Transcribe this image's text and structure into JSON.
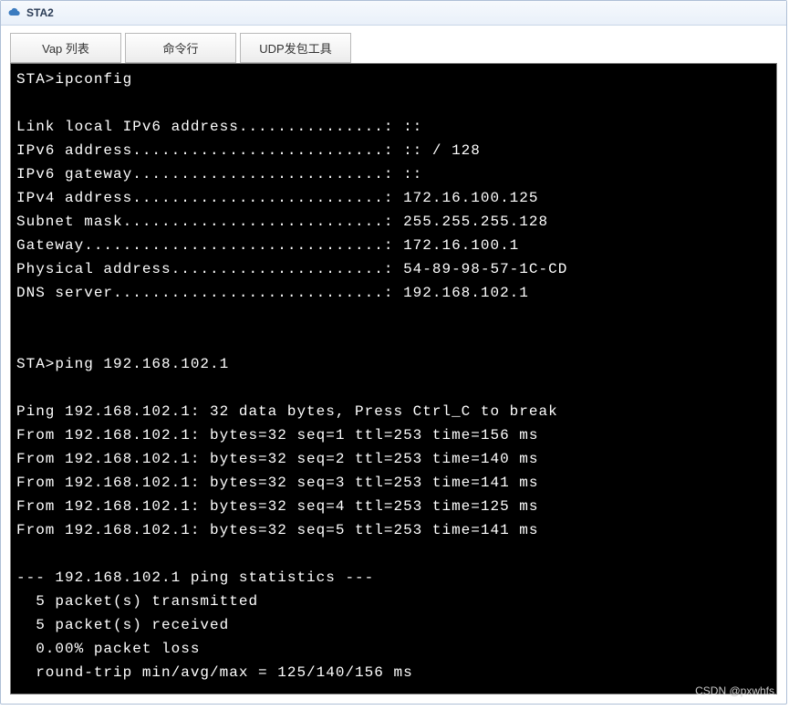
{
  "window": {
    "title": "STA2",
    "icon": "cloud-icon"
  },
  "tabs": [
    {
      "label": "Vap 列表"
    },
    {
      "label": "命令行"
    },
    {
      "label": "UDP发包工具"
    }
  ],
  "terminal": {
    "prompt1": "STA>",
    "cmd1": "ipconfig",
    "ipconfig": {
      "link_local_ipv6_label": "Link local IPv6 address",
      "link_local_ipv6": "::",
      "ipv6_addr_label": "IPv6 address",
      "ipv6_addr": ":: / 128",
      "ipv6_gw_label": "IPv6 gateway",
      "ipv6_gw": "::",
      "ipv4_addr_label": "IPv4 address",
      "ipv4_addr": "172.16.100.125",
      "subnet_label": "Subnet mask",
      "subnet": "255.255.255.128",
      "gateway_label": "Gateway",
      "gateway": "172.16.100.1",
      "phys_label": "Physical address",
      "phys": "54-89-98-57-1C-CD",
      "dns_label": "DNS server",
      "dns": "192.168.102.1"
    },
    "prompt2": "STA>",
    "cmd2": "ping 192.168.102.1",
    "ping": {
      "header": "Ping 192.168.102.1: 32 data bytes, Press Ctrl_C to break",
      "replies": [
        "From 192.168.102.1: bytes=32 seq=1 ttl=253 time=156 ms",
        "From 192.168.102.1: bytes=32 seq=2 ttl=253 time=140 ms",
        "From 192.168.102.1: bytes=32 seq=3 ttl=253 time=141 ms",
        "From 192.168.102.1: bytes=32 seq=4 ttl=253 time=125 ms",
        "From 192.168.102.1: bytes=32 seq=5 ttl=253 time=141 ms"
      ],
      "stats_hdr": "--- 192.168.102.1 ping statistics ---",
      "stats": [
        "  5 packet(s) transmitted",
        "  5 packet(s) received",
        "  0.00% packet loss",
        "  round-trip min/avg/max = 125/140/156 ms"
      ]
    }
  },
  "watermark": "CSDN @pxwhfs"
}
